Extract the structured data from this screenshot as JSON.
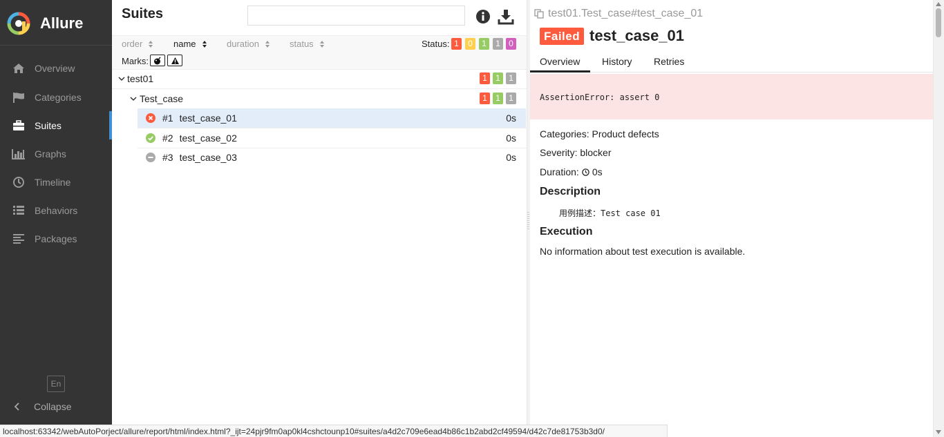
{
  "sidebar": {
    "brand": "Allure",
    "items": [
      {
        "label": "Overview",
        "icon": "home-icon"
      },
      {
        "label": "Categories",
        "icon": "flag-icon"
      },
      {
        "label": "Suites",
        "icon": "briefcase-icon",
        "active": true
      },
      {
        "label": "Graphs",
        "icon": "bar-chart-icon"
      },
      {
        "label": "Timeline",
        "icon": "clock-icon"
      },
      {
        "label": "Behaviors",
        "icon": "list-icon"
      },
      {
        "label": "Packages",
        "icon": "align-left-icon"
      }
    ],
    "language": "En",
    "collapse": "Collapse"
  },
  "suites": {
    "title": "Suites",
    "search_value": "",
    "sort": {
      "order": "order",
      "name": "name",
      "duration": "duration",
      "status": "status"
    },
    "status_label": "Status:",
    "status_counts": [
      {
        "value": "1",
        "color": "#fd5a3e"
      },
      {
        "value": "0",
        "color": "#ffd050"
      },
      {
        "value": "1",
        "color": "#97cc64"
      },
      {
        "value": "1",
        "color": "#aaaaaa"
      },
      {
        "value": "0",
        "color": "#d35ebe"
      }
    ],
    "marks_label": "Marks:",
    "tree": {
      "root": {
        "name": "test01",
        "counts": [
          "1",
          "1",
          "1"
        ]
      },
      "child": {
        "name": "Test_case",
        "counts": [
          "1",
          "1",
          "1"
        ]
      },
      "cases": [
        {
          "num": "#1",
          "name": "test_case_01",
          "duration": "0s",
          "status": "failed"
        },
        {
          "num": "#2",
          "name": "test_case_02",
          "duration": "0s",
          "status": "passed"
        },
        {
          "num": "#3",
          "name": "test_case_03",
          "duration": "0s",
          "status": "skipped"
        }
      ]
    }
  },
  "detail": {
    "path": "test01.Test_case#test_case_01",
    "status_badge": "Failed",
    "title": "test_case_01",
    "tabs": [
      "Overview",
      "History",
      "Retries"
    ],
    "error": "AssertionError: assert 0",
    "categories_label": "Categories:",
    "categories_value": "Product defects",
    "severity_label": "Severity:",
    "severity_value": "blocker",
    "duration_label": "Duration:",
    "duration_value": "0s",
    "description_heading": "Description",
    "description_text": "用例描述：Test case 01",
    "execution_heading": "Execution",
    "execution_text": "No information about test execution is available."
  },
  "statusbar": {
    "url": "localhost:63342/webAutoPorject/allure/report/html/index.html?_ijt=24pjr9fm0ap0kl4cshctounp10#suites/a4d2c709e6ead4b86c1b2abd2cf49594/d42c7de81753b3d0/"
  },
  "colors": {
    "sidebar_bg": "#343434",
    "active_accent": "#3f8fd5",
    "failed": "#fd5a3e",
    "passed": "#97cc64",
    "skipped": "#aaaaaa",
    "broken": "#ffd050",
    "unknown": "#d35ebe",
    "error_bg": "#fde4e4",
    "selected_row": "#e3edfa"
  }
}
